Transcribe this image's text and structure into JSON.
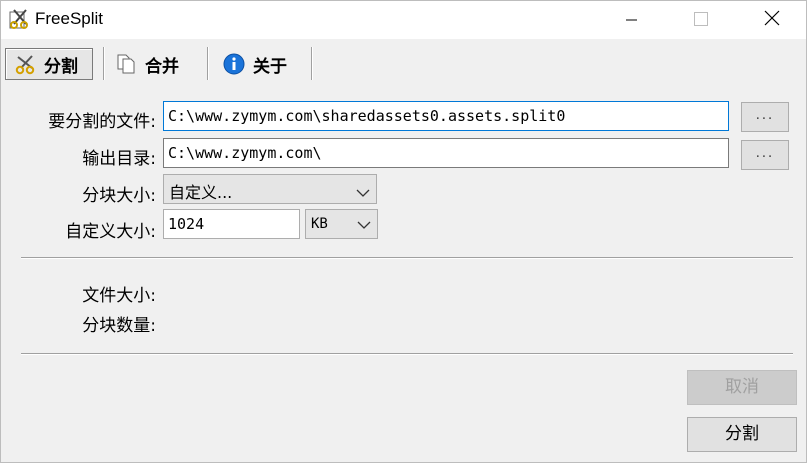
{
  "window": {
    "title": "FreeSplit",
    "icons": {
      "app": "scissors-app-icon",
      "minimize": "minimize-icon",
      "maximize": "maximize-icon",
      "close": "close-icon"
    }
  },
  "toolbar": {
    "tabs": [
      {
        "label": "分割",
        "icon": "scissors-icon",
        "selected": true
      },
      {
        "label": "合并",
        "icon": "documents-icon",
        "selected": false
      },
      {
        "label": "关于",
        "icon": "info-icon",
        "selected": false
      }
    ]
  },
  "form": {
    "source_file": {
      "label": "要分割的文件:",
      "value": "C:\\www.zymym.com\\sharedassets0.assets.split0",
      "browse_label": "..."
    },
    "output_dir": {
      "label": "输出目录:",
      "value": "C:\\www.zymym.com\\",
      "browse_label": "..."
    },
    "chunk_size": {
      "label": "分块大小:",
      "selected": "自定义..."
    },
    "custom_size": {
      "label": "自定义大小:",
      "value": "1024",
      "unit": "KB"
    }
  },
  "info": {
    "file_size_label": "文件大小:",
    "chunk_count_label": "分块数量:"
  },
  "buttons": {
    "cancel": {
      "label": "取消",
      "enabled": false
    },
    "split": {
      "label": "分割",
      "enabled": true
    }
  },
  "colors": {
    "focus_border": "#0078d7",
    "window_bg": "#f0f0f0",
    "info_icon": "#1a73d9"
  }
}
